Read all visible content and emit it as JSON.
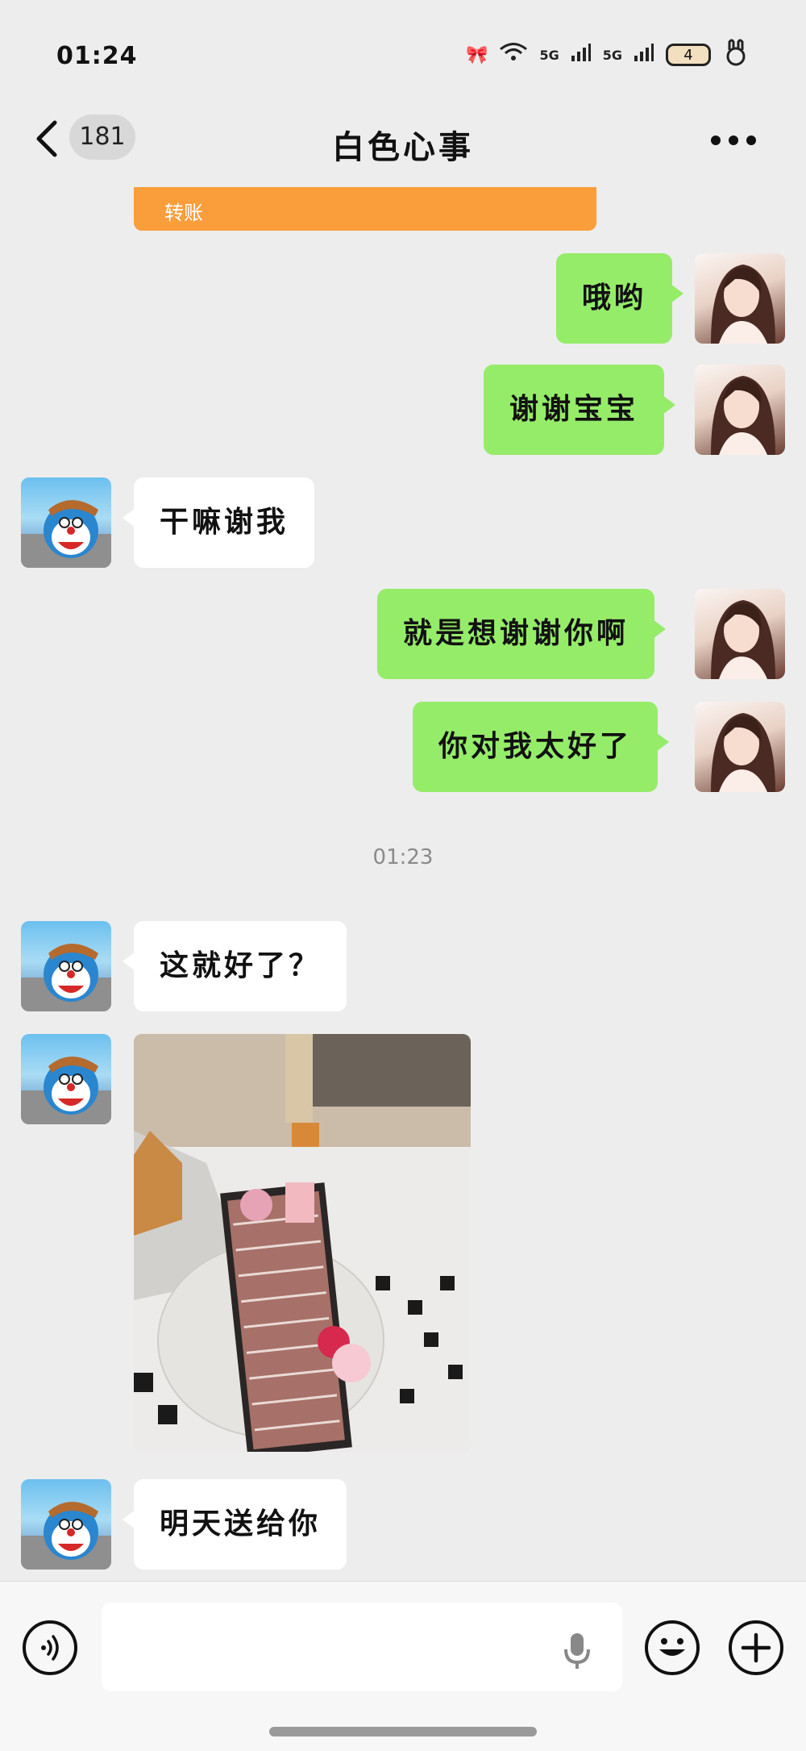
{
  "status_bar": {
    "time": "01:24",
    "signal_1": "5G",
    "signal_2": "5G",
    "battery_level": "4"
  },
  "nav": {
    "unread_count": "181",
    "title": "白色心事"
  },
  "transfer_card": {
    "label": "转账",
    "color": "#fa9d3b"
  },
  "messages": [
    {
      "sender": "me",
      "text": "哦哟"
    },
    {
      "sender": "me",
      "text": "谢谢宝宝"
    },
    {
      "sender": "them",
      "text": "干嘛谢我"
    },
    {
      "sender": "me",
      "text": "就是想谢谢你啊"
    },
    {
      "sender": "me",
      "text": "你对我太好了"
    },
    {
      "sender": "them",
      "text": "这就好了？"
    },
    {
      "sender": "them",
      "type": "image"
    },
    {
      "sender": "them",
      "text": "明天送给你"
    }
  ],
  "timestamp": "01:23",
  "input_bar": {
    "placeholder": ""
  },
  "colors": {
    "my_bubble": "#95ec69",
    "their_bubble": "#ffffff",
    "background": "#ededed"
  }
}
